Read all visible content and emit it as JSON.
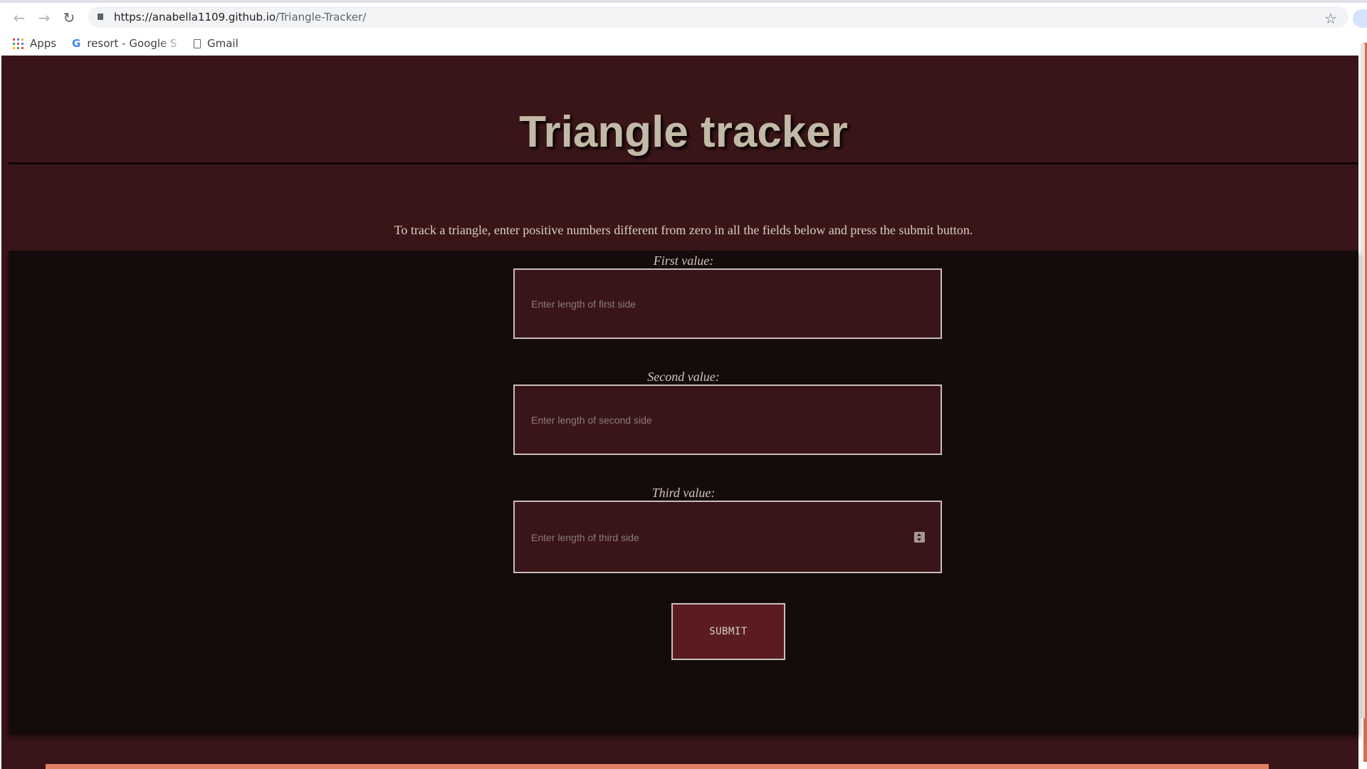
{
  "browser": {
    "nav": {
      "back_icon": "back-arrow-icon",
      "forward_icon": "forward-arrow-icon",
      "reload_icon": "reload-icon"
    },
    "url_host": "https://anabella1109.github.io",
    "url_path": "/Triangle-Tracker/",
    "bookmarks": [
      {
        "label": "Apps",
        "icon": "apps-grid-icon"
      },
      {
        "label": "resort - Google S",
        "icon": "google-g-icon"
      },
      {
        "label": "Gmail",
        "icon": "page-icon"
      }
    ]
  },
  "page": {
    "title": "Triangle tracker",
    "intro": "To track a triangle, enter positive numbers different from zero in all the fields below and press the submit button.",
    "fields": [
      {
        "label": "First value:",
        "placeholder": "Enter length of first side"
      },
      {
        "label": "Second value:",
        "placeholder": "Enter length of second side"
      },
      {
        "label": "Third value:",
        "placeholder": "Enter length of third side"
      }
    ],
    "submit_label": "SUBMIT"
  },
  "colors": {
    "header_bg": "#3a1517",
    "form_bg": "#150b0b",
    "title_color": "#c2b9a6",
    "button_bg": "#5a1c20",
    "accent_strip": "#e28064"
  }
}
